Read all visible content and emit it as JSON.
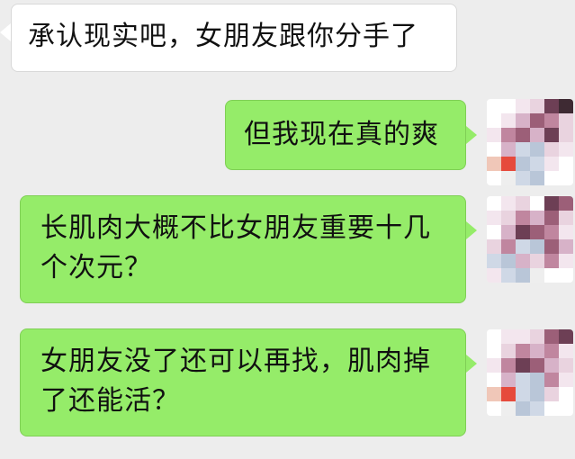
{
  "chat": {
    "messages": [
      {
        "side": "left",
        "text": "承认现实吧，女朋友跟你分手了"
      },
      {
        "side": "right",
        "text": "但我现在真的爽"
      },
      {
        "side": "right",
        "text": "长肌肉大概不比女朋友重要十几个次元？"
      },
      {
        "side": "right",
        "text": "女朋友没了还可以再找，肌肉掉了还能活？"
      }
    ]
  },
  "avatar": {
    "icon": "pixelated-avatar-icon",
    "palette": [
      "#ffffff",
      "#f3e6ee",
      "#e9d3df",
      "#d7b2c8",
      "#c0869f",
      "#9c5f78",
      "#6d3f55",
      "#3e2a33",
      "#cfd8e6",
      "#b9c6d8",
      "#e64a3c",
      "#f0c7b8",
      "#eeeeee"
    ]
  }
}
